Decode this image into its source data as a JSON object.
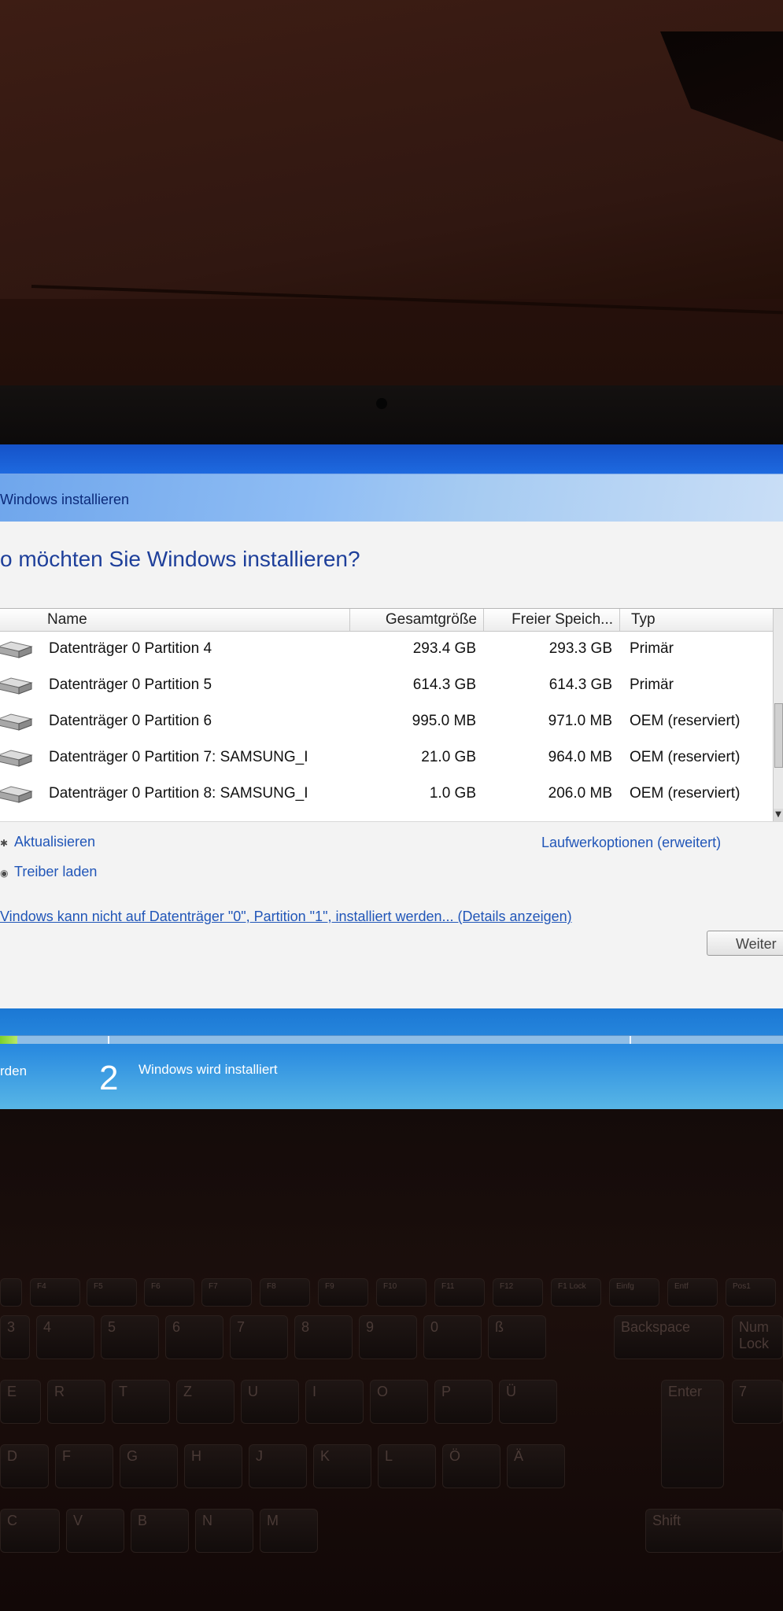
{
  "window": {
    "title": "Windows installieren",
    "heading": "o möchten Sie Windows installieren?"
  },
  "table": {
    "columns": {
      "name": "Name",
      "total": "Gesamtgröße",
      "free": "Freier Speich...",
      "type": "Typ"
    },
    "rows": [
      {
        "name": "Datenträger 0 Partition 4",
        "total": "293.4 GB",
        "free": "293.3 GB",
        "type": "Primär"
      },
      {
        "name": "Datenträger 0 Partition 5",
        "total": "614.3 GB",
        "free": "614.3 GB",
        "type": "Primär"
      },
      {
        "name": "Datenträger 0 Partition 6",
        "total": "995.0 MB",
        "free": "971.0 MB",
        "type": "OEM (reserviert)"
      },
      {
        "name": "Datenträger 0 Partition 7: SAMSUNG_I",
        "total": "21.0 GB",
        "free": "964.0 MB",
        "type": "OEM (reserviert)"
      },
      {
        "name": "Datenträger 0 Partition 8: SAMSUNG_I",
        "total": "1.0 GB",
        "free": "206.0 MB",
        "type": "OEM (reserviert)"
      }
    ]
  },
  "actions": {
    "refresh": "Aktualisieren",
    "load_driver": "Treiber laden",
    "drive_options": "Laufwerkoptionen (erweitert)",
    "warning": "Vindows kann nicht auf Datenträger \"0\", Partition \"1\", installiert werden... (Details anzeigen)",
    "next": "Weiter"
  },
  "progress": {
    "prev_step": "rden",
    "step_number": "2",
    "step_label": "Windows wird installiert"
  },
  "keyboard": {
    "fkeys": [
      "F4",
      "F5",
      "F6",
      "F7",
      "F8",
      "F9",
      "F10",
      "F11",
      "F12",
      "F1 Lock",
      "Einfg",
      "Entf",
      "Pos1"
    ],
    "row_numbers": [
      "3",
      "4",
      "5",
      "6",
      "7",
      "8",
      "9",
      "0",
      "ß",
      "Backspace",
      "Num Lock"
    ],
    "row_top": [
      "E",
      "R",
      "T",
      "Z",
      "U",
      "I",
      "O",
      "P",
      "Ü",
      "Enter",
      "7"
    ],
    "row_home": [
      "D",
      "F",
      "G",
      "H",
      "J",
      "K",
      "L",
      "Ö",
      "Ä"
    ],
    "row_bottom": [
      "C",
      "V",
      "B",
      "N",
      "M",
      "Shift"
    ]
  },
  "icons": {
    "refresh": "refresh-icon",
    "driver": "driver-disc-icon",
    "disk": "hard-disk-icon"
  }
}
